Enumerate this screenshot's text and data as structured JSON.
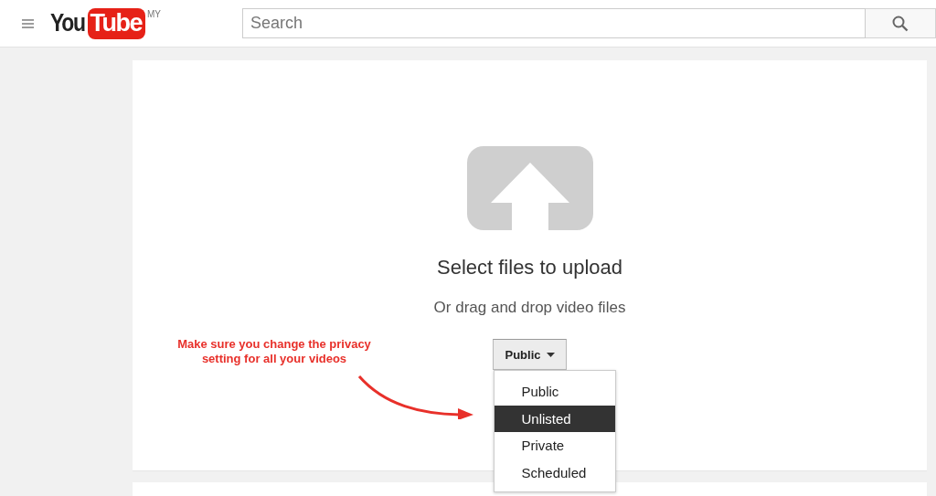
{
  "header": {
    "logo": {
      "text_1": "You",
      "text_2": "Tube"
    },
    "region": "MY",
    "search": {
      "placeholder": "Search"
    }
  },
  "upload": {
    "title": "Select files to upload",
    "subtitle": "Or drag and drop video files",
    "privacy_button": {
      "label": "Public"
    },
    "privacy_menu": [
      {
        "label": "Public",
        "selected": false
      },
      {
        "label": "Unlisted",
        "selected": true
      },
      {
        "label": "Private",
        "selected": false
      },
      {
        "label": "Scheduled",
        "selected": false
      }
    ]
  },
  "annotation": {
    "text": "Make sure you change the privacy setting for all your videos"
  }
}
